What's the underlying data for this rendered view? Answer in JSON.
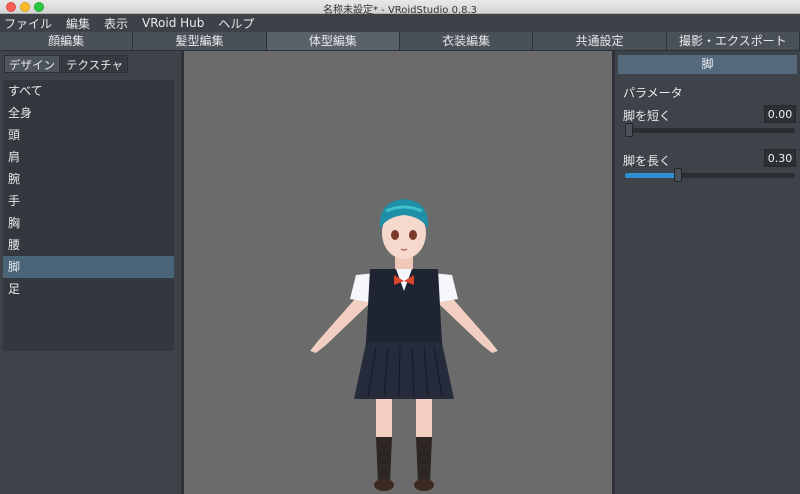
{
  "window": {
    "title": "名称未設定* - VRoidStudio 0.8.3"
  },
  "menu": [
    "ファイル",
    "編集",
    "表示",
    "VRoid Hub",
    "ヘルプ"
  ],
  "main_tabs": [
    {
      "label": "顔編集"
    },
    {
      "label": "髪型編集"
    },
    {
      "label": "体型編集",
      "active": true
    },
    {
      "label": "衣装編集"
    },
    {
      "label": "共通設定"
    },
    {
      "label": "撮影・エクスポート"
    }
  ],
  "left_panel": {
    "sub_tabs": [
      {
        "label": "デザイン",
        "active": true
      },
      {
        "label": "テクスチャ"
      }
    ],
    "parts": [
      "すべて",
      "全身",
      "頭",
      "肩",
      "腕",
      "手",
      "胸",
      "腰",
      "脚",
      "足"
    ],
    "selected_part": "脚"
  },
  "right_panel": {
    "header": "脚",
    "section": "パラメータ",
    "params": [
      {
        "label": "脚を短く",
        "value": "0.00",
        "level": 0.0
      },
      {
        "label": "脚を長く",
        "value": "0.30",
        "level": 0.3
      }
    ]
  },
  "colors": {
    "accent": "#2f8fd3",
    "selected_row": "#4a6478",
    "panel_header": "#546a7c",
    "viewport_bg": "#6b6b6b"
  }
}
